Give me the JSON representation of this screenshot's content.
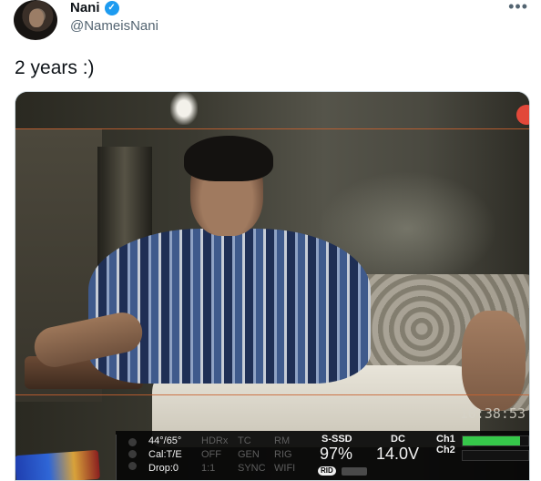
{
  "tweet": {
    "display_name": "Nani",
    "handle": "@NameisNani",
    "text": "2 years :)",
    "verified_icon": "check-icon",
    "more_icon": "more-icon"
  },
  "camera_hud": {
    "timecode": "10:38:53",
    "col1": [
      "44°/65°",
      "Cal:T/E",
      "Drop:0"
    ],
    "col2": [
      "HDRx",
      "OFF",
      "1:1"
    ],
    "col3": [
      "TC",
      "GEN",
      "SYNC"
    ],
    "col4": [
      "RM",
      "RIG",
      "WIFI"
    ],
    "media_label": "S-SSD",
    "media_value": "97%",
    "rid_label": "RID",
    "power_label": "DC",
    "power_value": "14.0V",
    "ch1_label": "Ch1",
    "ch2_label": "Ch2",
    "ch1_level": 0.88
  },
  "colors": {
    "accent": "#1d9bf0",
    "frame_line": "#c9622f",
    "rec": "#e2483a",
    "meter": "#36c84a"
  }
}
